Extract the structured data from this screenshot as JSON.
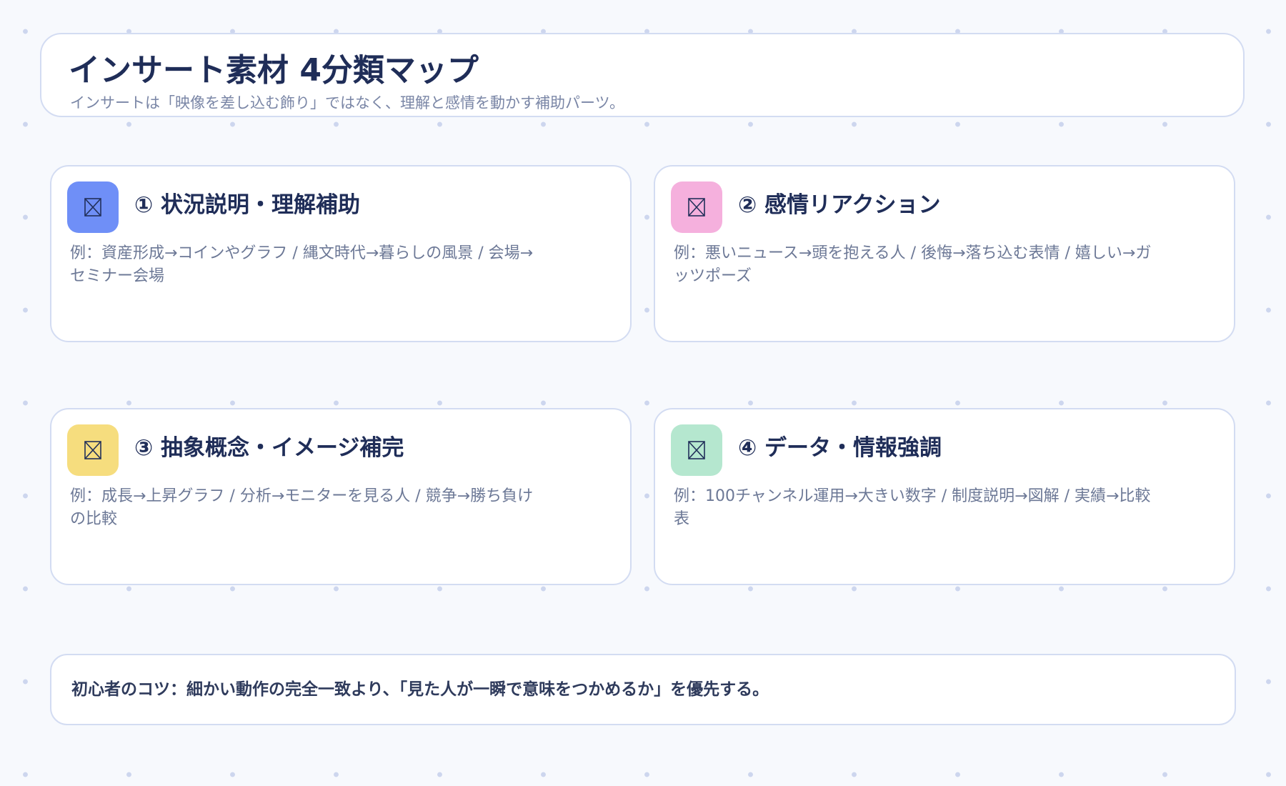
{
  "header": {
    "title": "インサート素材 4分類マップ",
    "subtitle": "インサートは「映像を差し込む飾り」ではなく、理解と感情を動かす補助パーツ。"
  },
  "categories": [
    {
      "title": "① 状況説明・理解補助",
      "example": "例：資産形成→コインやグラフ / 縄文時代→暮らしの風景 / 会場→セミナー会場",
      "icon": "image-placeholder-icon",
      "color": "#6f8ff7"
    },
    {
      "title": "② 感情リアクション",
      "example": "例：悪いニュース→頭を抱える人 / 後悔→落ち込む表情 / 嬉しい→ガッツポーズ",
      "icon": "image-placeholder-icon",
      "color": "#f5b0dd"
    },
    {
      "title": "③ 抽象概念・イメージ補完",
      "example": "例：成長→上昇グラフ / 分析→モニターを見る人 / 競争→勝ち負けの比較",
      "icon": "image-placeholder-icon",
      "color": "#f6dd7e"
    },
    {
      "title": "④ データ・情報強調",
      "example": "例：100チャンネル運用→大きい数字 / 制度説明→図解 / 実績→比較表",
      "icon": "image-placeholder-icon",
      "color": "#b5e7cf"
    }
  ],
  "tip": {
    "text": "初心者のコツ：細かい動作の完全一致より、「見た人が一瞬で意味をつかめるか」を優先する。"
  }
}
